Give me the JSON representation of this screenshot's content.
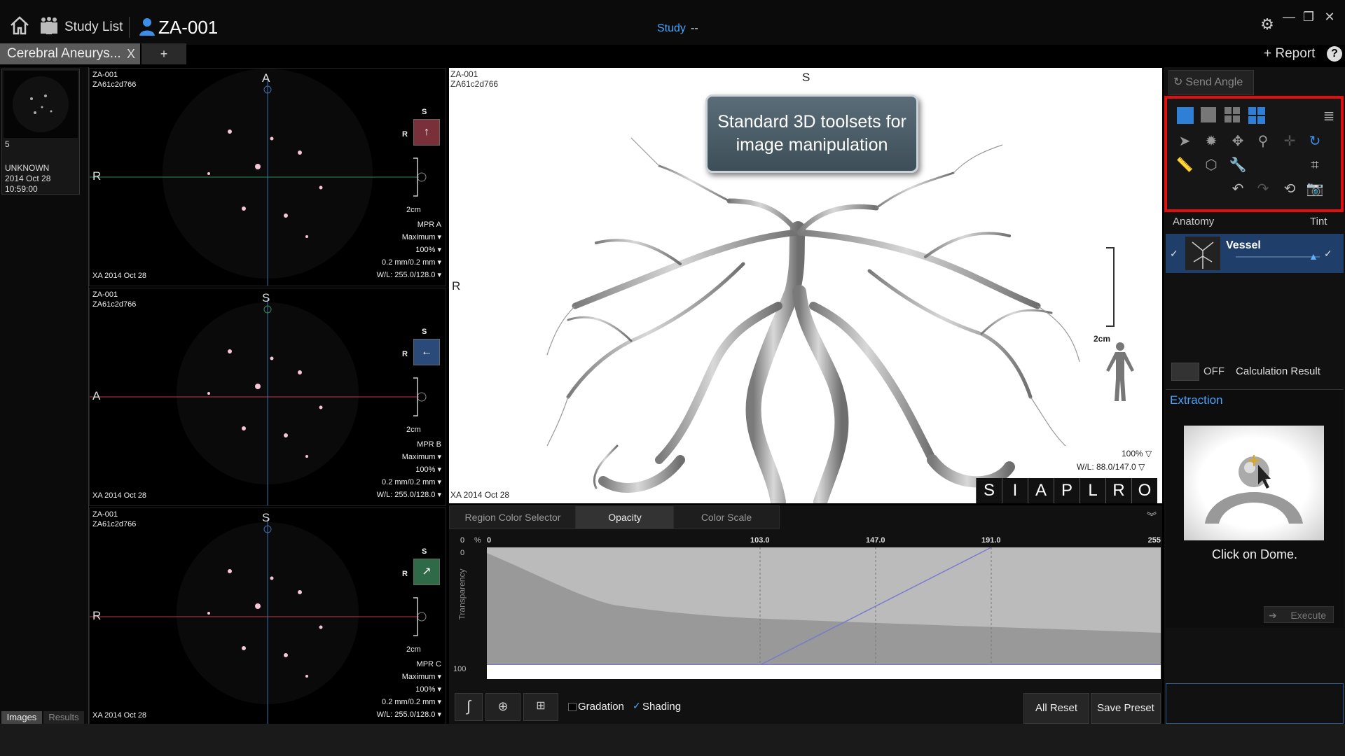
{
  "topbar": {
    "study_list_label": "Study List",
    "patient_id": "ZA-001",
    "study_label": "Study",
    "study_value": "--",
    "report_label": "+ Report",
    "icons": [
      "home-icon",
      "study-list-icon",
      "user-icon",
      "settings-icon",
      "minimize-icon",
      "restore-icon",
      "close-icon",
      "help-icon"
    ]
  },
  "tabs": {
    "case_tab_label": "Cerebral Aneurys...",
    "case_tab_close": "X",
    "add_tab": "+"
  },
  "thumbnail": {
    "count": "5",
    "name": "UNKNOWN",
    "date": "2014 Oct 28",
    "time": "10:59:00"
  },
  "left_tabs": [
    "Images",
    "Results"
  ],
  "mpr_views": [
    {
      "id_line1": "ZA-001",
      "id_line2": "ZA61c2d766",
      "top_marker": "A",
      "left_marker": "R",
      "orient_s": "S",
      "orient_r": "R",
      "scale": "2cm",
      "name": "MPR A",
      "mode": "Maximum",
      "zoom": "100%",
      "thickness": "0.2 mm/0.2 mm",
      "wl": "W/L: 255.0/128.0",
      "date": "XA 2014 Oct 28",
      "accent": "#2e8b57"
    },
    {
      "id_line1": "ZA-001",
      "id_line2": "ZA61c2d766",
      "top_marker": "S",
      "left_marker": "A",
      "orient_s": "S",
      "orient_r": "R",
      "scale": "2cm",
      "name": "MPR B",
      "mode": "Maximum",
      "zoom": "100%",
      "thickness": "0.2 mm/0.2 mm",
      "wl": "W/L: 255.0/128.0",
      "date": "XA 2014 Oct 28",
      "accent": "#c0394b"
    },
    {
      "id_line1": "ZA-001",
      "id_line2": "ZA61c2d766",
      "top_marker": "S",
      "left_marker": "R",
      "orient_s": "S",
      "orient_r": "R",
      "scale": "2cm",
      "name": "MPR C",
      "mode": "Maximum",
      "zoom": "100%",
      "thickness": "0.2 mm/0.2 mm",
      "wl": "W/L: 255.0/128.0",
      "date": "XA 2014 Oct 28",
      "accent": "#c0394b"
    }
  ],
  "vr_view": {
    "id_line1": "ZA-001",
    "id_line2": "ZA61c2d766",
    "top_marker": "S",
    "left_marker": "R",
    "scale": "2cm",
    "zoom": "100%",
    "wl": "W/L: 88.0/147.0",
    "date": "XA 2014 Oct 28",
    "callout": "Standard 3D toolsets for image manipulation",
    "orientation_buttons": [
      "S",
      "I",
      "A",
      "P",
      "L",
      "R",
      "O"
    ]
  },
  "right_panel": {
    "send_angle": "Send Angle",
    "anatomy_label": "Anatomy",
    "tint_label": "Tint",
    "vessel_label": "Vessel",
    "toggle_state": "OFF",
    "calc_result": "Calculation Result",
    "extraction_label": "Extraction",
    "extraction_hint": "Click on Dome.",
    "execute_label": "Execute",
    "highlight_color": "#e01010",
    "accent_color": "#4aa3ff"
  },
  "bottom_panel": {
    "tabs": [
      "Region Color Selector",
      "Opacity",
      "Color Scale"
    ],
    "active_tab": "Opacity",
    "axis_left_top": "0",
    "axis_percent": "%",
    "axis_left_zero": "0",
    "axis_left_bottom": "100",
    "y_axis_label": "Transparency",
    "ticks": [
      "0",
      "103.0",
      "147.0",
      "191.0",
      "255"
    ],
    "gradation_label": "Gradation",
    "shading_label": "Shading",
    "all_reset": "All Reset",
    "save_preset": "Save Preset"
  }
}
